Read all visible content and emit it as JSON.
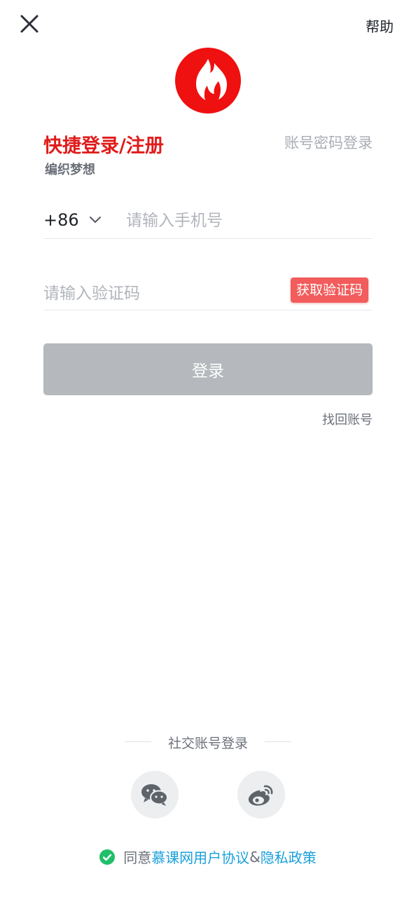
{
  "header": {
    "help_label": "帮助"
  },
  "brand": {
    "color": "#ef1010"
  },
  "login": {
    "title": "快捷登录/注册",
    "subtitle": "编织梦想",
    "password_login_label": "账号密码登录",
    "country_code": "+86",
    "phone_placeholder": "请输入手机号",
    "code_placeholder": "请输入验证码",
    "get_code_label": "获取验证码",
    "submit_label": "登录",
    "recover_label": "找回账号"
  },
  "social": {
    "title": "社交账号登录",
    "providers": [
      "wechat-icon",
      "weibo-icon"
    ]
  },
  "agreement": {
    "prefix": "同意",
    "user_agreement": "慕课网用户协议",
    "separator": "&",
    "privacy_policy": "隐私政策",
    "checked": true
  }
}
